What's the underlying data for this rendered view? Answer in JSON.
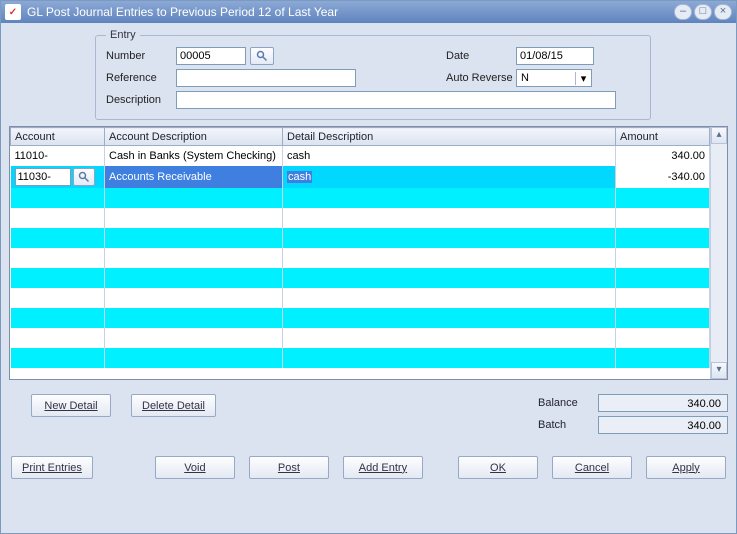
{
  "window": {
    "title": "GL Post Journal Entries to Previous Period 12 of Last Year"
  },
  "entry": {
    "legend": "Entry",
    "number_label": "Number",
    "number_value": "00005",
    "reference_label": "Reference",
    "reference_value": "",
    "description_label": "Description",
    "description_value": "",
    "date_label": "Date",
    "date_value": "01/08/15",
    "autoreverse_label": "Auto Reverse",
    "autoreverse_value": "N"
  },
  "grid": {
    "headers": {
      "account": "Account",
      "account_desc": "Account Description",
      "detail_desc": "Detail Description",
      "amount": "Amount"
    },
    "rows": [
      {
        "account": "11010-",
        "account_desc": "Cash in Banks (System Checking)",
        "detail_desc": "cash",
        "amount": "340.00",
        "selected": false
      },
      {
        "account": "11030-",
        "account_desc": "Accounts Receivable",
        "detail_desc": "cash",
        "amount": "-340.00",
        "selected": true
      }
    ]
  },
  "detail_buttons": {
    "new_detail": "New Detail",
    "delete_detail": "Delete Detail"
  },
  "totals": {
    "balance_label": "Balance",
    "balance_value": "340.00",
    "batch_label": "Batch",
    "batch_value": "340.00"
  },
  "footer": {
    "print_entries": "Print Entries",
    "void": "Void",
    "post": "Post",
    "add_entry": "Add Entry",
    "ok": "OK",
    "cancel": "Cancel",
    "apply": "Apply"
  }
}
